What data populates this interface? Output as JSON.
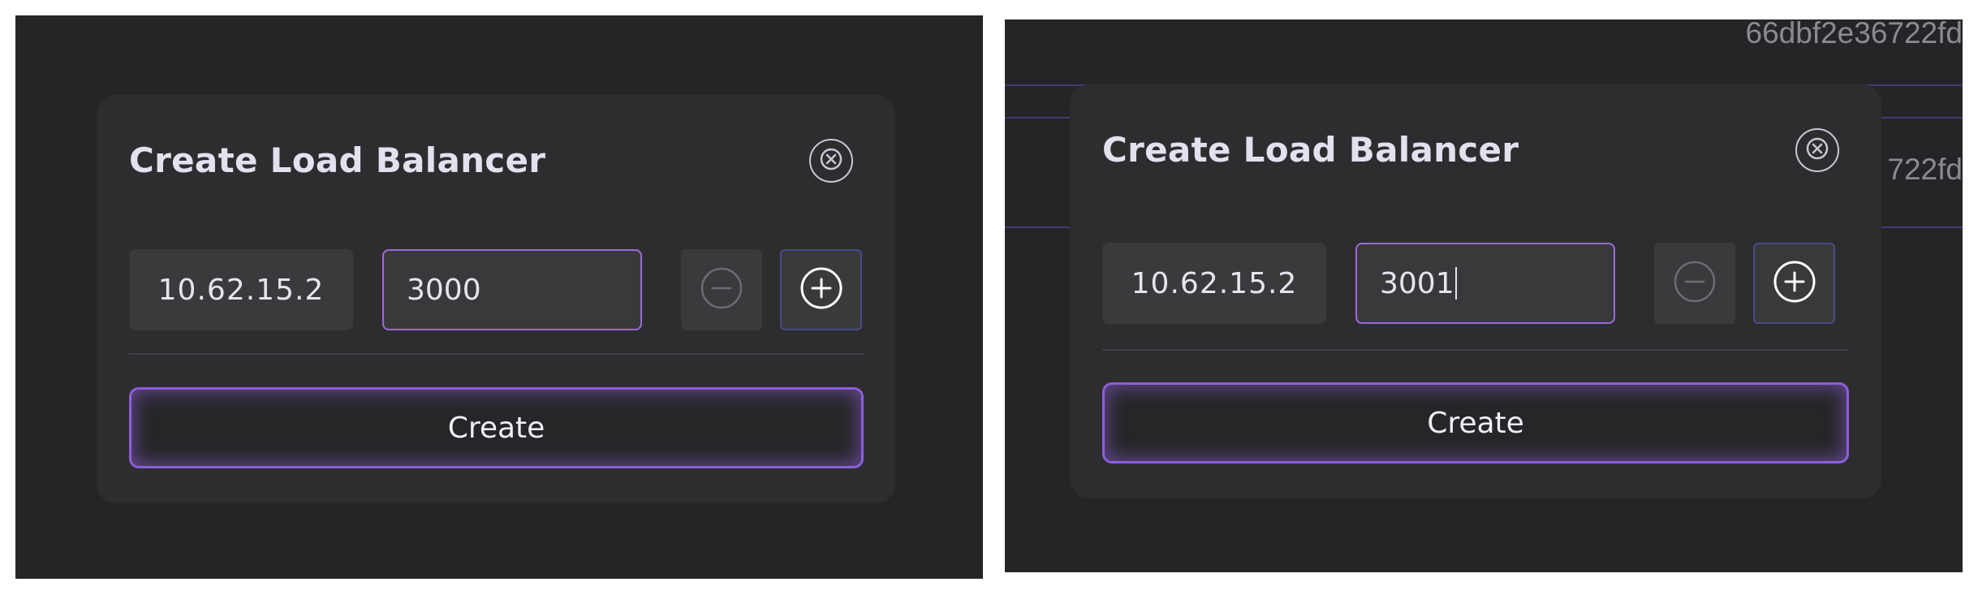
{
  "panels": [
    {
      "dialog": {
        "title": "Create Load Balancer",
        "ip": "10.62.15.2",
        "port_value": "3000",
        "create_label": "Create"
      }
    },
    {
      "background": {
        "hash_top": "66dbf2e36722fd",
        "hash_mid": "722fd"
      },
      "dialog": {
        "title": "Create Load Balancer",
        "ip": "10.62.15.2",
        "port_value": "3001",
        "create_label": "Create"
      }
    }
  ],
  "colors": {
    "accent": "#9d6ad6",
    "background": "#252528",
    "dialog": "#2d2d30",
    "field": "#3a3a3d"
  },
  "icons": {
    "close": "close-circle-icon",
    "minus": "minus-circle-icon",
    "plus": "plus-circle-icon"
  }
}
